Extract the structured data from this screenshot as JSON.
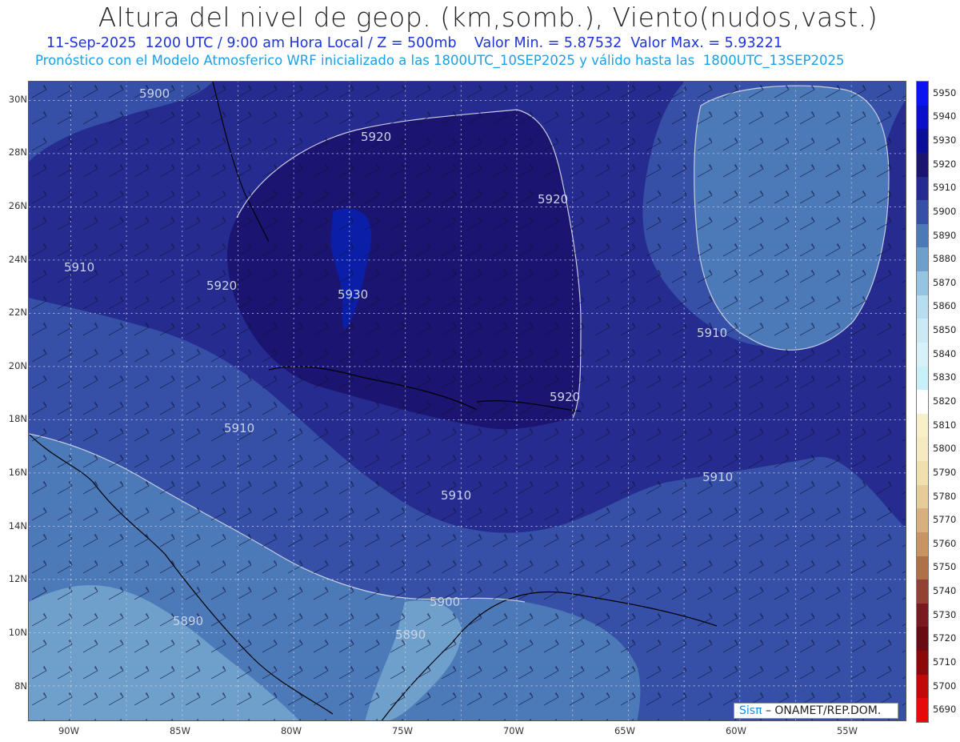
{
  "header": {
    "title": "Altura del nivel de geop. (km,somb.), Viento(nudos,vast.)",
    "subtitle_line1": "11-Sep-2025  1200 UTC / 9:00 am Hora Local / Z = 500mb    Valor Min. = 5.87532  Valor Max. = 5.93221",
    "subtitle_line2": "Pronóstico con el Modelo Atmosferico WRF inicializado a las 1800UTC_10SEP2025 y válido hasta las  1800UTC_13SEP2025"
  },
  "map": {
    "lat_labels": [
      "30N",
      "28N",
      "26N",
      "24N",
      "22N",
      "20N",
      "18N",
      "16N",
      "14N",
      "12N",
      "10N",
      "8N"
    ],
    "lon_labels": [
      "90W",
      "85W",
      "80W",
      "75W",
      "70W",
      "65W",
      "60W",
      "55W"
    ],
    "contour_labels": [
      "5900",
      "5920",
      "5920",
      "5910",
      "5920",
      "5930",
      "5910",
      "5920",
      "5910",
      "5910",
      "5910",
      "5900",
      "5890",
      "5890"
    ],
    "credit": {
      "brand": "Sisπ",
      "text": "– ONAMET/REP.DOM."
    }
  },
  "colorbar": {
    "levels": [
      "5950",
      "5940",
      "5930",
      "5920",
      "5910",
      "5900",
      "5890",
      "5880",
      "5870",
      "5860",
      "5850",
      "5840",
      "5830",
      "5820",
      "5810",
      "5800",
      "5790",
      "5780",
      "5770",
      "5760",
      "5750",
      "5740",
      "5730",
      "5720",
      "5710",
      "5700",
      "5690"
    ],
    "colors": [
      "#0a14f0",
      "#0a10c8",
      "#0b0e96",
      "#1b1470",
      "#262b90",
      "#3550a6",
      "#4c79b8",
      "#6fa0cc",
      "#94c4e2",
      "#b6def0",
      "#cbeaf5",
      "#d8f0f8",
      "#c8f0f8",
      "#ffffff",
      "#f8f0c8",
      "#f5eac0",
      "#f0e0b0",
      "#e6cc98",
      "#d8b07c",
      "#c89460",
      "#b07048",
      "#944032",
      "#7a1a20",
      "#6a0a12",
      "#8a0a0a",
      "#c00a0a",
      "#e80a0a"
    ]
  }
}
